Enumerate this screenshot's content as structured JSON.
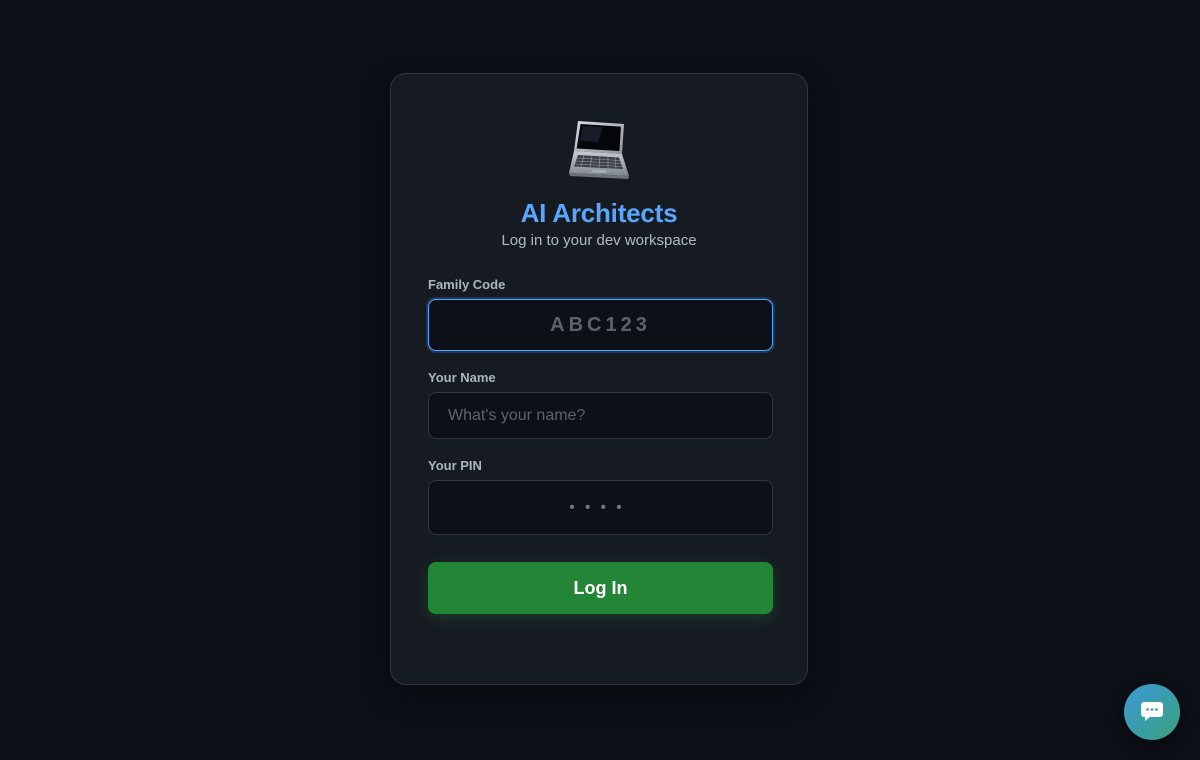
{
  "app": {
    "logo_icon": "laptop-icon",
    "title": "AI Architects",
    "subtitle": "Log in to your dev workspace"
  },
  "form": {
    "family_code": {
      "label": "Family Code",
      "placeholder": "ABC123",
      "value": ""
    },
    "name": {
      "label": "Your Name",
      "placeholder": "What's your name?",
      "value": ""
    },
    "pin": {
      "label": "Your PIN",
      "placeholder": "••••",
      "value": ""
    },
    "submit_label": "Log In"
  },
  "chat": {
    "icon": "chat-bubble-icon"
  },
  "colors": {
    "background": "#0c1017",
    "card": "#161b22",
    "accent": "#58a6ff",
    "button": "#238636"
  }
}
